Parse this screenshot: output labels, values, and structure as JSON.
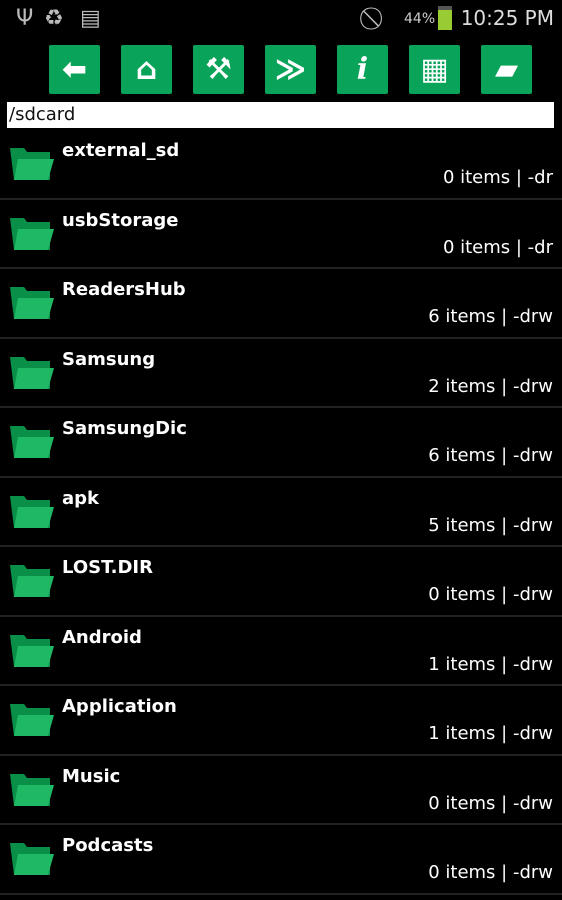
{
  "status_bar": {
    "icons": [
      "usb-icon",
      "recycle-icon",
      "sim-card-alert-icon",
      "no-signal-icon"
    ],
    "battery": "44%",
    "time": "10:25 PM"
  },
  "toolbar": [
    {
      "name": "back",
      "icon": "arrow-left-icon",
      "glyph": "⬅"
    },
    {
      "name": "home",
      "icon": "home-icon",
      "glyph": "⌂"
    },
    {
      "name": "tools",
      "icon": "tools-icon",
      "glyph": "⚒"
    },
    {
      "name": "multi-select",
      "icon": "double-check-icon",
      "glyph": "≫"
    },
    {
      "name": "info",
      "icon": "info-icon",
      "glyph": "i"
    },
    {
      "name": "grid-view",
      "icon": "grid-icon",
      "glyph": "▦"
    },
    {
      "name": "open-folder",
      "icon": "folder-open-icon",
      "glyph": "▰"
    }
  ],
  "path": "/sdcard",
  "colors": {
    "accent": "#0aa35a",
    "folder_back": "#0a8f48",
    "folder_front": "#1fb865"
  },
  "files": [
    {
      "name": "external_sd",
      "meta": "0 items | -dr"
    },
    {
      "name": "usbStorage",
      "meta": "0 items | -dr"
    },
    {
      "name": "ReadersHub",
      "meta": "6 items | -drw"
    },
    {
      "name": "Samsung",
      "meta": "2 items | -drw"
    },
    {
      "name": "SamsungDic",
      "meta": "6 items | -drw"
    },
    {
      "name": "apk",
      "meta": "5 items | -drw"
    },
    {
      "name": "LOST.DIR",
      "meta": "0 items | -drw"
    },
    {
      "name": "Android",
      "meta": "1 items | -drw"
    },
    {
      "name": "Application",
      "meta": "1 items | -drw"
    },
    {
      "name": "Music",
      "meta": "0 items | -drw"
    },
    {
      "name": "Podcasts",
      "meta": "0 items | -drw"
    }
  ]
}
